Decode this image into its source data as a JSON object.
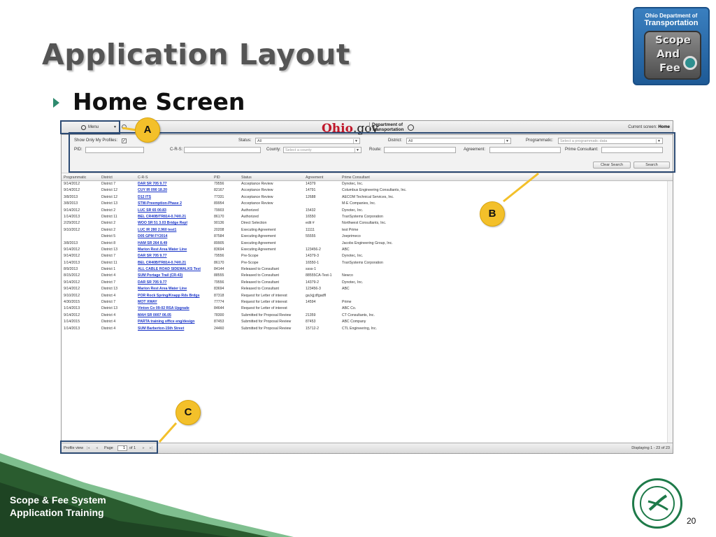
{
  "slide": {
    "title": "Application Layout",
    "subtitle": "Home Screen",
    "footer_line1": "Scope & Fee System",
    "footer_line2": "Application Training",
    "page_number": "20",
    "logo": {
      "line1": "Ohio Department of",
      "line2": "Transportation",
      "word1": "Scope",
      "word2": "And",
      "word3": "Fee"
    },
    "callouts": {
      "a": "A",
      "b": "B",
      "c": "C"
    },
    "colors": {
      "callout": "#f3c02a",
      "frame": "#2c4a73",
      "green": "#1e7a49"
    }
  },
  "app": {
    "menu_label": "Menu",
    "brand": {
      "ohio": "Ohio",
      "gov": ".gov",
      "dept_line1": "Department of",
      "dept_line2": "Transportation"
    },
    "current_screen_label": "Current screen:",
    "current_screen_value": "Home",
    "filters": {
      "show_profiles_label": "Show Only My Profiles:",
      "show_profiles_checked": "✓",
      "status_label": "Status:",
      "status_value": "All",
      "district_label": "District:",
      "district_value": "All",
      "programmatic_label": "Programmatic:",
      "programmatic_placeholder": "Select a programmatic data",
      "pid_label": "PID:",
      "crs_label": "C-R-S:",
      "county_label": "County:",
      "county_placeholder": "Select a county",
      "route_label": "Route:",
      "agreement_label": "Agreement:",
      "prime_consultant_label": "Prime Consultant:",
      "clear_button": "Clear Search",
      "search_button": "Search"
    },
    "grid": {
      "columns": [
        "Programmatic",
        "District",
        "C-R-S",
        "PID",
        "Status",
        "Agreement",
        "Prime Consultant"
      ],
      "rows": [
        [
          "9/14/2012",
          "District 7",
          "DAR SR 705 9.77",
          "79556",
          "Acceptance Review",
          "14379",
          "Dynotec, Inc."
        ],
        [
          "9/14/2012",
          "District 12",
          "CUY IR 090 18.20",
          "82167",
          "Acceptance Review",
          "14791",
          "Columbus Engineering Consultants, Inc."
        ],
        [
          "3/8/2013",
          "District 12",
          "D12 ITS",
          "77331",
          "Acceptance Review",
          "12688",
          "AECOM Technical Services, Inc."
        ],
        [
          "3/8/2013",
          "District 13",
          "STW-Preemption-Phase 2",
          "89954",
          "Acceptance Review",
          "",
          "M-E Companies, Inc."
        ],
        [
          "9/14/2012",
          "District 2",
          "LUC SR 65 00.83",
          "79903",
          "Authorized",
          "15432",
          "Dynotec, Inc."
        ],
        [
          "1/14/2013",
          "District 11",
          "BEL CR40B/TR814-0.74/0.21",
          "86170",
          "Authorized",
          "16550",
          "TranSystems Corporation"
        ],
        [
          "2/29/2012",
          "District 2",
          "WOO SR 51 3.03 Bridge Repl",
          "90136",
          "Direct Selection",
          "edit #",
          "Northwest Consultants, Inc."
        ],
        [
          "9/10/2012",
          "District 2",
          "LUC IR 280 2.960 test1",
          "20208",
          "Executing Agreement",
          "11111",
          "test Prime"
        ],
        [
          "",
          "District 5",
          "D05 GPM FY2014",
          "87584",
          "Executing Agreement",
          "55555",
          "Joeprimeco"
        ],
        [
          "3/8/2013",
          "District 8",
          "HAM SR 264 8.49",
          "89905",
          "Executing Agreement",
          "",
          "Jacobs Engineering Group, Inc."
        ],
        [
          "9/14/2012",
          "District 13",
          "Marion Rest Area Water Line",
          "83694",
          "Executing Agreement",
          "123456-2",
          "ABC"
        ],
        [
          "9/14/2012",
          "District 7",
          "DAR SR 705 9.77",
          "79556",
          "Pre-Scope",
          "14379-3",
          "Dynotec, Inc."
        ],
        [
          "1/14/2013",
          "District 11",
          "BEL CR40B/TR814-0.74/0.21",
          "86170",
          "Pre-Scope",
          "16550-1",
          "TranSystems Corporation"
        ],
        [
          "8/9/2013",
          "District 1",
          "ALL CABLE ROAD SIDEWALKS Test",
          "84144",
          "Released to Consultant",
          "ssss-1",
          ""
        ],
        [
          "8/15/2012",
          "District 4",
          "SUM Portage Trail (CR-43)",
          "88555",
          "Released to Consultant",
          "88555CA-Test-1",
          "Newco"
        ],
        [
          "9/14/2012",
          "District 7",
          "DAR SR 705 9.77",
          "79556",
          "Released to Consultant",
          "14379-2",
          "Dynotec, Inc."
        ],
        [
          "9/14/2012",
          "District 13",
          "Marion Rest Area Water Line",
          "83694",
          "Released to Consultant",
          "123456-3",
          "ABC"
        ],
        [
          "9/10/2012",
          "District 4",
          "POR Rock Spring/Knapp Rds Brdgs",
          "87318",
          "Request for Letter of interest",
          "ga;kjj;dfgadfl",
          ""
        ],
        [
          "4/30/2015",
          "District 7",
          "MOT XWAY",
          "77774",
          "Request for Letter of interest",
          "14594",
          "Prime"
        ],
        [
          "1/14/2013",
          "District 13",
          "Vinton Co 09-02 RSA Upgrade",
          "84644",
          "Request for Letter of interest",
          "",
          "ABC Co."
        ],
        [
          "9/14/2012",
          "District 4",
          "MAH SR 0007 06.05",
          "78300",
          "Submitted for Proposal Review",
          "21359",
          "CT Consultants, Inc."
        ],
        [
          "1/14/2015",
          "District 4",
          "PARTA training office eng/design",
          "87453",
          "Submitted for Proposal Review",
          "87453",
          "ABC Company"
        ],
        [
          "1/14/2013",
          "District 4",
          "SUM Barberton-15th Street",
          "24460",
          "Submitted for Proposal Review",
          "15712-2",
          "CTL Engineering, Inc."
        ]
      ]
    },
    "pager": {
      "profile_view": "Profile view",
      "page_label": "Page",
      "page_value": "1",
      "of_label": "of 1",
      "displaying": "Displaying 1 - 23 of 23"
    }
  }
}
